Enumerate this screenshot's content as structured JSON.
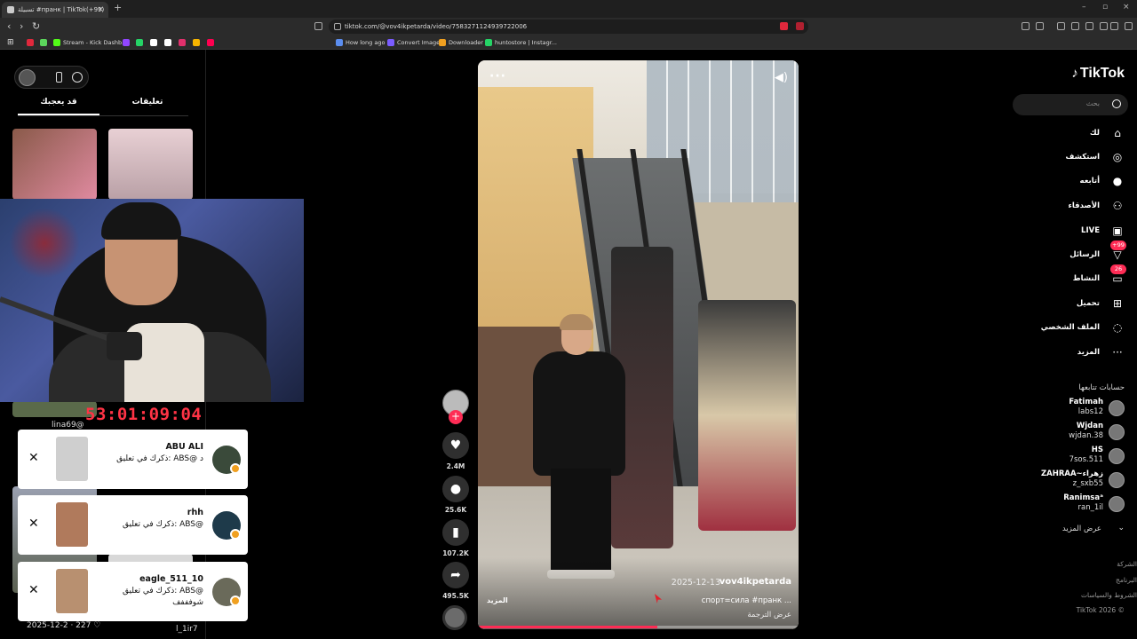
{
  "browser": {
    "tab_title": "تسبيلة #пранк | TikTok(+99)",
    "url": "tiktok.com/@vov4ikpetarda/video/7583271124939722006",
    "bookmarks": [
      {
        "label": "",
        "color": "#e0283c"
      },
      {
        "label": "",
        "color": "#5cd65c"
      },
      {
        "label": "Stream - Kick Dashb...",
        "color": "#53fc18"
      },
      {
        "label": "",
        "color": "#9146ff"
      },
      {
        "label": "",
        "color": "#25d366"
      },
      {
        "label": "",
        "color": "#ffffff"
      },
      {
        "label": "",
        "color": "#ffffff"
      },
      {
        "label": "",
        "color": "#e1306c"
      },
      {
        "label": "",
        "color": "#f7b500"
      },
      {
        "label": "",
        "color": "#ff0050"
      },
      {
        "label": "How long ago",
        "color": "#5b8def"
      },
      {
        "label": "Convert Image",
        "color": "#7a5cff"
      },
      {
        "label": "Downloader",
        "color": "#f0a020"
      },
      {
        "label": "huntostore | Instagr...",
        "color": "#25d366"
      }
    ]
  },
  "left_panel": {
    "tabs": [
      "تعليقات",
      "قد يعجبك"
    ],
    "timer": "53:01:09:04",
    "user_label": "lina69@",
    "notifications": [
      {
        "name": "ABU ALI",
        "text": "ذكرك في تعليق: ABS@ د",
        "text2": "",
        "avatar_color": "#3a4a3a",
        "thumb_color": "#cfcfcf"
      },
      {
        "name": "rhh",
        "text": "ذكرك في تعليق: ABS@",
        "text2": "",
        "avatar_color": "#1e3a4a",
        "thumb_color": "#b07a5c"
      },
      {
        "name": "eagle_511_10",
        "text": "ذكرك في تعليق: ABS@",
        "text2": "شوفففف",
        "avatar_color": "#6a6a5a",
        "thumb_color": "#b89070"
      }
    ],
    "bottom_meta": "2025-12-2 · 227 ♡",
    "bottom_user": "l_1ir7"
  },
  "actions": {
    "likes": "2.4M",
    "comments": "25.6K",
    "saves": "107.2K",
    "shares": "495.5K"
  },
  "video": {
    "author": "vov4ikpetarda",
    "date": "2025-12-13",
    "caption": "спорт=сила #пранк ...",
    "more_label": "المزيد",
    "translate_label": "عرض الترجمة",
    "progress": 0.56
  },
  "sidebar": {
    "logo": "TikTok",
    "search_placeholder": "بحث",
    "nav": [
      {
        "label": "لك",
        "icon": "home-icon",
        "glyph": "⌂",
        "badge": ""
      },
      {
        "label": "استكشف",
        "icon": "compass-icon",
        "glyph": "◎",
        "badge": ""
      },
      {
        "label": "أتابعه",
        "icon": "following-avatar-icon",
        "glyph": "●",
        "badge": ""
      },
      {
        "label": "الأصدقاء",
        "icon": "friends-icon",
        "glyph": "⚇",
        "badge": ""
      },
      {
        "label": "LIVE",
        "icon": "live-icon",
        "glyph": "▣",
        "badge": ""
      },
      {
        "label": "الرسائل",
        "icon": "messages-icon",
        "glyph": "▽",
        "badge": "+99"
      },
      {
        "label": "النشاط",
        "icon": "activity-icon",
        "glyph": "▭",
        "badge": "26"
      },
      {
        "label": "تحميل",
        "icon": "upload-icon",
        "glyph": "⊞",
        "badge": ""
      },
      {
        "label": "الملف الشخصي",
        "icon": "profile-icon",
        "glyph": "◌",
        "badge": ""
      },
      {
        "label": "المزيد",
        "icon": "more-icon",
        "glyph": "···",
        "badge": ""
      }
    ],
    "following_title": "حسابات تتابعها",
    "following": [
      {
        "name": "Fatimah",
        "user": "labs12"
      },
      {
        "name": "Wjdan",
        "user": "wjdan.38"
      },
      {
        "name": "HS",
        "user": "7sos.511"
      },
      {
        "name": "ZAHRAA~زهراء",
        "user": "z_sxb55"
      },
      {
        "name": "Ranimsaᵃ",
        "user": "ran_1il"
      }
    ],
    "see_more": "عرض المزيد",
    "footer": [
      "الشركة",
      "البرنامج",
      "الشروط والسياسات",
      "TikTok 2026 ©"
    ]
  }
}
